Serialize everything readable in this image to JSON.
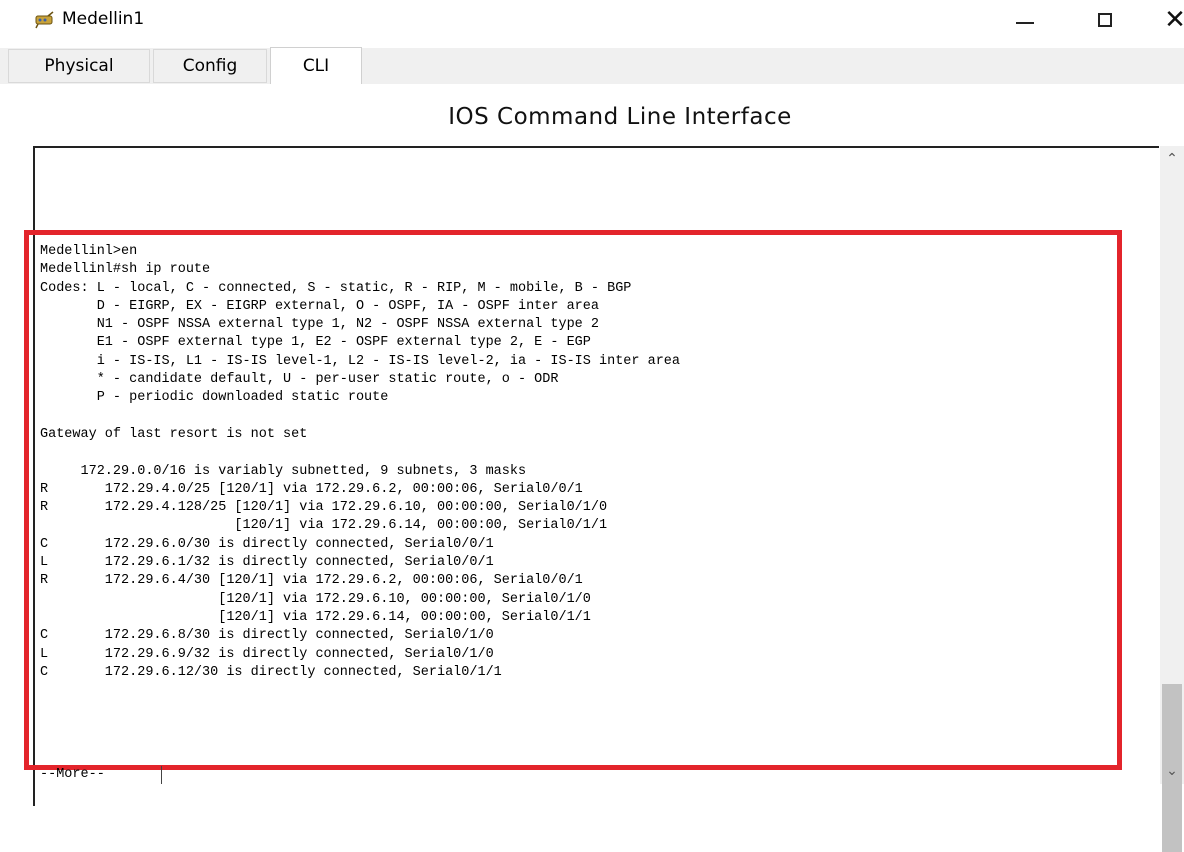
{
  "window": {
    "title": "Medellin1",
    "icon": "router-icon",
    "controls": {
      "minimize": "—",
      "maximize": "☐",
      "close": "✕"
    }
  },
  "tabs": [
    {
      "label": "Physical",
      "active": false
    },
    {
      "label": "Config",
      "active": false
    },
    {
      "label": "CLI",
      "active": true
    }
  ],
  "cli": {
    "heading": "IOS Command Line Interface",
    "output_lines": [
      "Medellinl>en",
      "Medellinl#sh ip route",
      "Codes: L - local, C - connected, S - static, R - RIP, M - mobile, B - BGP",
      "       D - EIGRP, EX - EIGRP external, O - OSPF, IA - OSPF inter area",
      "       N1 - OSPF NSSA external type 1, N2 - OSPF NSSA external type 2",
      "       E1 - OSPF external type 1, E2 - OSPF external type 2, E - EGP",
      "       i - IS-IS, L1 - IS-IS level-1, L2 - IS-IS level-2, ia - IS-IS inter area",
      "       * - candidate default, U - per-user static route, o - ODR",
      "       P - periodic downloaded static route",
      "",
      "Gateway of last resort is not set",
      "",
      "     172.29.0.0/16 is variably subnetted, 9 subnets, 3 masks",
      "R       172.29.4.0/25 [120/1] via 172.29.6.2, 00:00:06, Serial0/0/1",
      "R       172.29.4.128/25 [120/1] via 172.29.6.10, 00:00:00, Serial0/1/0",
      "                        [120/1] via 172.29.6.14, 00:00:00, Serial0/1/1",
      "C       172.29.6.0/30 is directly connected, Serial0/0/1",
      "L       172.29.6.1/32 is directly connected, Serial0/0/1",
      "R       172.29.6.4/30 [120/1] via 172.29.6.2, 00:00:06, Serial0/0/1",
      "                      [120/1] via 172.29.6.10, 00:00:00, Serial0/1/0",
      "                      [120/1] via 172.29.6.14, 00:00:00, Serial0/1/1",
      "C       172.29.6.8/30 is directly connected, Serial0/1/0",
      "L       172.29.6.9/32 is directly connected, Serial0/1/0",
      "C       172.29.6.12/30 is directly connected, Serial0/1/1"
    ],
    "more_prompt": "--More--"
  },
  "colors": {
    "highlight_border": "#e3242b",
    "tab_strip_bg": "#f0f0f0"
  }
}
